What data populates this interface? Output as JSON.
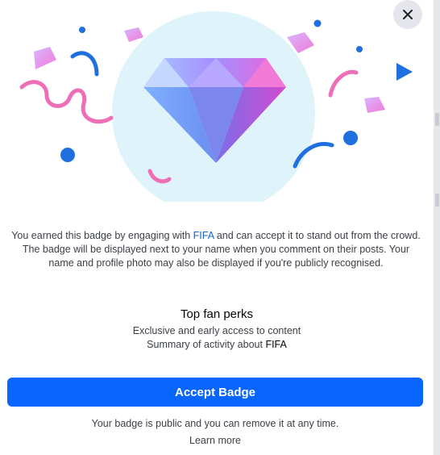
{
  "dialog": {
    "close_label": "Close",
    "icons": [
      "close-icon",
      "diamond-badge-icon",
      "confetti"
    ],
    "colors": {
      "accent": "#0866ff",
      "link": "#1763cf",
      "close_bg": "#e4e6eb"
    }
  },
  "description": {
    "part1": "You earned this badge by engaging with ",
    "entity": "FIFA",
    "part2": " and can accept it to stand out from the crowd. The badge will be displayed next to your name when you comment on their posts. Your name and profile photo may also be displayed if you're publicly recognised."
  },
  "perks": {
    "title": "Top fan perks",
    "item1": "Exclusive and early access to content",
    "item2_prefix": "Summary of activity about ",
    "item2_entity": "FIFA"
  },
  "accept_button": "Accept Badge",
  "footnote": "Your badge is public and you can remove it at any time.",
  "learn_more": "Learn more"
}
